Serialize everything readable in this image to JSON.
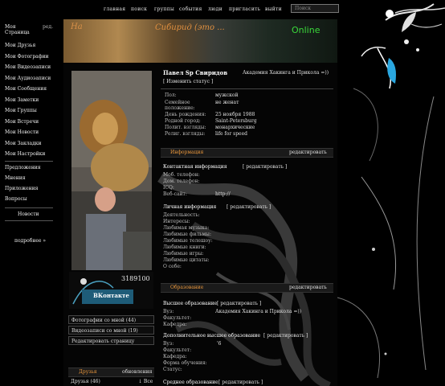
{
  "nav": {
    "items": [
      "главная",
      "поиск",
      "группы",
      "события",
      "люди",
      "пригласить",
      "выйти"
    ],
    "search_placeholder": "Поиск"
  },
  "banner": {
    "text_left": "На",
    "text_mid": "Сибирид (это ...",
    "online": "Online"
  },
  "left_menu": {
    "items": [
      "Моя Страница",
      "Мои Друзья",
      "Мои Фотографии",
      "Мои Видеозаписи",
      "Мои Аудиозаписи",
      "Мои Сообщения",
      "Мои Заметки",
      "Мои Группы",
      "Мои Встречи",
      "Мои Новости",
      "Мои Закладки",
      "Мои Настройки"
    ],
    "edit": "ред.",
    "items2": [
      "Предложения",
      "Мнения",
      "Приложения",
      "Вопросы"
    ],
    "news": "Новости",
    "more": "подробнее »"
  },
  "profile": {
    "name": "Павел  Sp  Свиридов",
    "university": "Академия Хакинга и Прикола =))",
    "status": "[ Изменить статус ]",
    "fields": [
      {
        "label": "Пол:",
        "value": "мужской"
      },
      {
        "label": "Семейное положение:",
        "value": "не женат"
      },
      {
        "label": "День рождения:",
        "value": "25 ноября 1988"
      },
      {
        "label": "Родной город:",
        "value": "Saint-Petersburg"
      },
      {
        "label": "Полит. взгляды:",
        "value": "монархические"
      },
      {
        "label": "Религ. взгляды:",
        "value": "life for speed"
      }
    ],
    "info_header": "Информация",
    "edit_label": "редактировать",
    "contact_header": "Контактная информация",
    "contact_edit": "[ редактировать ]",
    "contact_fields": [
      {
        "label": "Моб. телефон:",
        "value": ""
      },
      {
        "label": "Дом. телефон:",
        "value": ""
      },
      {
        "label": "ICQ:",
        "value": ""
      },
      {
        "label": "Веб-сайт:",
        "value": "http://"
      }
    ],
    "personal_header": "Личная информация",
    "personal_edit": "[ редактировать ]",
    "personal_fields": [
      "Деятельность:",
      "Интересы:",
      "Любимая музыка:",
      "Любимые фильмы:",
      "Любимые телешоу:",
      "Любимые книги:",
      "Любимые игры:",
      "Любимые цитаты:",
      "О себе:"
    ],
    "edu_header": "Образование",
    "higher_edu": "Высшее образование",
    "higher_edit": "[ редактировать ]",
    "higher_fields": [
      {
        "label": "Вуз:",
        "value": "Академия Хакинга и Прикола =))"
      },
      {
        "label": "Факультет:",
        "value": ""
      },
      {
        "label": "Кафедра:",
        "value": ""
      }
    ],
    "add_higher": "Дополнительное высшее образование",
    "add_higher_edit": "[ редактировать ]",
    "add_higher_fields": [
      {
        "label": "Вуз:",
        "value": "'6"
      },
      {
        "label": "Факультет:",
        "value": ""
      },
      {
        "label": "Кафедра:",
        "value": ""
      },
      {
        "label": "Форма обучения:",
        "value": ""
      },
      {
        "label": "Статус:",
        "value": ""
      }
    ],
    "secondary_edu": "Среднее образование",
    "secondary_edit": "[ редактировать ]"
  },
  "vk": {
    "id": "3189100",
    "logo": "ВКонтакте"
  },
  "photo_links": [
    "Фотографии со мной (44)",
    "Видеозаписи со мной (19)",
    "Редактировать страницу"
  ],
  "friends": {
    "header": "Друзья",
    "updates": "обновления",
    "count": "Друзья (46)",
    "all": "↓ Все"
  }
}
